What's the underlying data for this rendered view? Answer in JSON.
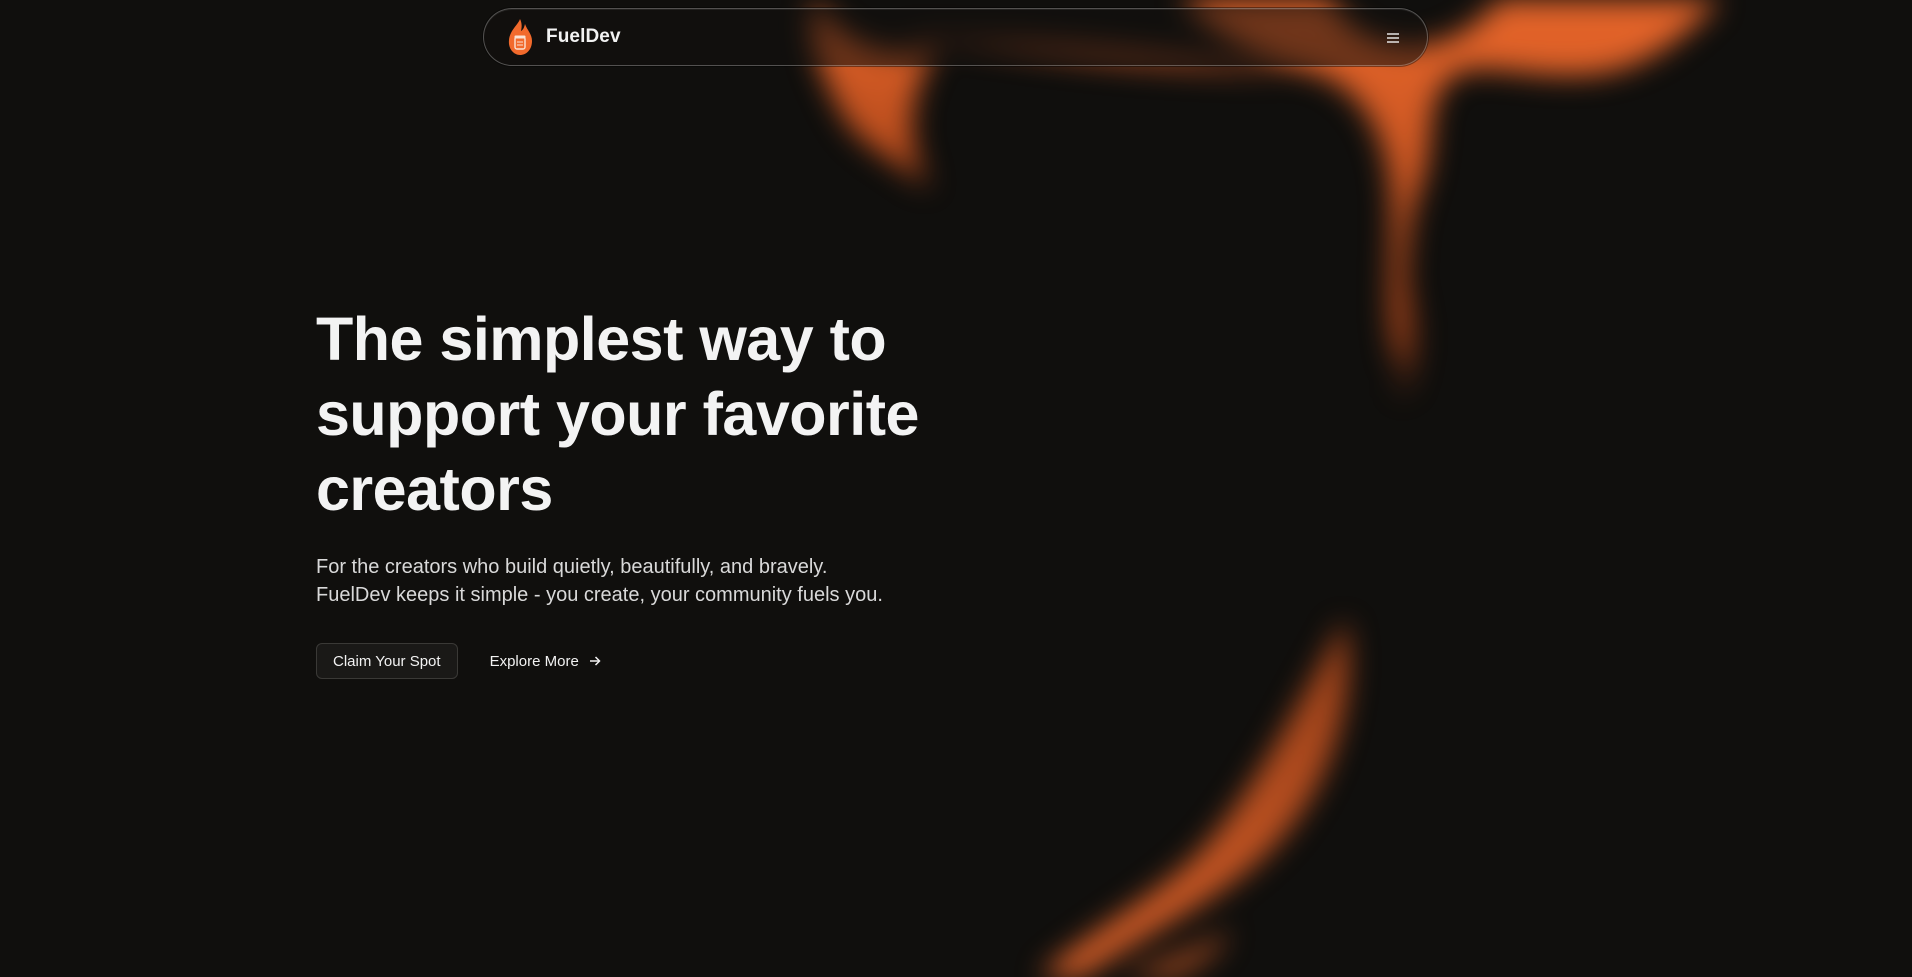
{
  "nav": {
    "brand_name": "FuelDev",
    "logo_icon": "flame-jar-icon",
    "menu_icon": "hamburger-menu-icon"
  },
  "hero": {
    "headline_lines": [
      "The simplest way to",
      "support your favorite",
      "creators"
    ],
    "subtitle_lines": [
      "For the creators who build quietly, beautifully, and bravely.",
      "FuelDev keeps it simple - you create, your community fuels you."
    ],
    "primary_button_label": "Claim Your Spot",
    "secondary_button_label": "Explore More",
    "secondary_button_icon": "arrow-right-icon"
  },
  "colors": {
    "background": "#100f0d",
    "accent": "#f26a2c",
    "text": "#f2f2f2"
  }
}
